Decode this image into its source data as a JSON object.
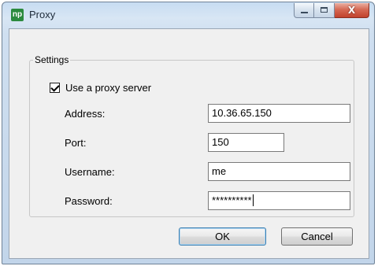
{
  "window": {
    "title": "Proxy",
    "app_icon_text": "np",
    "close_glyph": "X"
  },
  "settings": {
    "group_label": "Settings",
    "use_proxy": {
      "label": "Use a proxy server",
      "checked": true
    },
    "address": {
      "label": "Address:",
      "value": "10.36.65.150"
    },
    "port": {
      "label": "Port:",
      "value": "150"
    },
    "username": {
      "label": "Username:",
      "value": "me"
    },
    "password": {
      "label": "Password:",
      "value": "**********"
    }
  },
  "buttons": {
    "ok": "OK",
    "cancel": "Cancel"
  }
}
